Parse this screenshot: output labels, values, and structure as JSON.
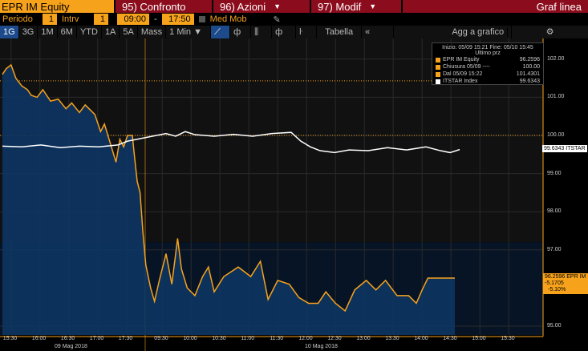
{
  "header": {
    "security": "EPR IM Equity",
    "compare": "95) Confronto",
    "actions": "96) Azioni",
    "modify": "97) Modif",
    "chart_type": "Graf linea"
  },
  "controls": {
    "period_label": "Periodo",
    "period": "1",
    "interval_label": "Intrv",
    "interval": "1",
    "start_time": "09:00",
    "dash": "-",
    "end_time": "17:50",
    "moving_avg": "Med Mob"
  },
  "toolbar": {
    "ranges": [
      "1G",
      "3G",
      "1M",
      "6M",
      "YTD",
      "1A",
      "5A",
      "Mass"
    ],
    "interval_select": "1 Min ▼",
    "table": "Tabella",
    "collapse": "«",
    "add_to_chart": "Agg a grafico",
    "settings": "⚙"
  },
  "legend": {
    "range": "Inizio: 05/09 15:21 Fine: 05/10 15:45",
    "header": "Ultimo prz",
    "items": [
      {
        "label": "EPR IM Equity",
        "value": "96.2596",
        "color": "#f7a21b"
      },
      {
        "label": "Chiusura 05/09 ---- ",
        "value": "100.00",
        "color": "#f7a21b"
      },
      {
        "label": "Dal 05/09 15:22",
        "value": "101.4301",
        "color": "#f7a21b"
      },
      {
        "label": "ITSTAR Index",
        "value": "99.6343",
        "color": "#ffffff"
      }
    ]
  },
  "tags": {
    "itstar": "99.6343 ITSTAR",
    "epr": "96.2596 EPR IM",
    "epr_chg": "-5.1705",
    "epr_pct": "-5.10%"
  },
  "chart_data": {
    "type": "line",
    "yticks": [
      "102.00",
      "101.00",
      "100.00",
      "99.00",
      "98.00",
      "97.00",
      "95.00"
    ],
    "ytick_values": [
      102,
      101,
      100,
      99,
      98,
      97,
      95
    ],
    "ylim": [
      94.8,
      102.7
    ],
    "xticks": [
      "15:30",
      "16:00",
      "16:30",
      "17:00",
      "17:30",
      "09:30",
      "10:00",
      "10:30",
      "11:00",
      "11:30",
      "12:00",
      "12:30",
      "13:00",
      "13:30",
      "14:00",
      "14:30",
      "15:00",
      "15:30"
    ],
    "xtick_minutes": [
      9,
      39,
      69,
      99,
      129,
      166,
      196,
      226,
      256,
      286,
      316,
      346,
      376,
      406,
      436,
      466,
      496,
      526
    ],
    "dates": [
      "09 Mag 2018",
      "10 Mag 2018"
    ],
    "reference_close": 100.0,
    "reference_start": 101.4301,
    "series": [
      {
        "name": "EPR IM Equity",
        "color": "#f7a21b",
        "points": [
          [
            0,
            101.6
          ],
          [
            4,
            101.75
          ],
          [
            9,
            101.85
          ],
          [
            14,
            101.5
          ],
          [
            20,
            101.3
          ],
          [
            26,
            101.2
          ],
          [
            30,
            101.05
          ],
          [
            36,
            101.0
          ],
          [
            42,
            101.2
          ],
          [
            50,
            100.9
          ],
          [
            58,
            100.95
          ],
          [
            66,
            100.7
          ],
          [
            72,
            100.85
          ],
          [
            80,
            100.6
          ],
          [
            86,
            100.8
          ],
          [
            96,
            100.55
          ],
          [
            102,
            100.1
          ],
          [
            106,
            100.3
          ],
          [
            112,
            99.8
          ],
          [
            118,
            99.3
          ],
          [
            122,
            99.9
          ],
          [
            126,
            99.7
          ],
          [
            130,
            100.0
          ],
          [
            135,
            100.0
          ],
          [
            137,
            99.5
          ],
          [
            140,
            98.8
          ],
          [
            143,
            98.5
          ],
          [
            146,
            97.45
          ],
          [
            149,
            96.6
          ],
          [
            154,
            96.0
          ],
          [
            158,
            95.65
          ],
          [
            163,
            96.2
          ],
          [
            170,
            96.9
          ],
          [
            176,
            96.1
          ],
          [
            182,
            97.3
          ],
          [
            186,
            96.5
          ],
          [
            192,
            96.0
          ],
          [
            200,
            95.8
          ],
          [
            208,
            96.3
          ],
          [
            214,
            96.55
          ],
          [
            220,
            95.9
          ],
          [
            230,
            96.3
          ],
          [
            245,
            96.55
          ],
          [
            258,
            96.3
          ],
          [
            268,
            96.7
          ],
          [
            276,
            95.7
          ],
          [
            286,
            96.2
          ],
          [
            298,
            96.1
          ],
          [
            308,
            95.75
          ],
          [
            318,
            95.6
          ],
          [
            328,
            95.6
          ],
          [
            336,
            95.9
          ],
          [
            346,
            95.6
          ],
          [
            356,
            95.4
          ],
          [
            366,
            95.95
          ],
          [
            378,
            96.2
          ],
          [
            388,
            95.95
          ],
          [
            398,
            96.2
          ],
          [
            410,
            95.8
          ],
          [
            422,
            95.8
          ],
          [
            430,
            95.6
          ],
          [
            436,
            95.95
          ],
          [
            442,
            96.26
          ],
          [
            470,
            96.26
          ]
        ]
      },
      {
        "name": "ITSTAR Index",
        "color": "#ffffff",
        "points": [
          [
            0,
            99.72
          ],
          [
            20,
            99.7
          ],
          [
            40,
            99.75
          ],
          [
            60,
            99.68
          ],
          [
            80,
            99.72
          ],
          [
            100,
            99.7
          ],
          [
            120,
            99.75
          ],
          [
            130,
            99.85
          ],
          [
            140,
            99.9
          ],
          [
            150,
            99.95
          ],
          [
            160,
            100.0
          ],
          [
            170,
            100.05
          ],
          [
            180,
            99.98
          ],
          [
            190,
            100.1
          ],
          [
            200,
            100.02
          ],
          [
            220,
            99.98
          ],
          [
            240,
            100.03
          ],
          [
            260,
            99.98
          ],
          [
            280,
            100.05
          ],
          [
            300,
            100.08
          ],
          [
            310,
            99.85
          ],
          [
            320,
            99.7
          ],
          [
            330,
            99.6
          ],
          [
            345,
            99.55
          ],
          [
            360,
            99.62
          ],
          [
            380,
            99.6
          ],
          [
            400,
            99.68
          ],
          [
            420,
            99.62
          ],
          [
            440,
            99.7
          ],
          [
            455,
            99.6
          ],
          [
            465,
            99.55
          ],
          [
            475,
            99.63
          ]
        ]
      }
    ]
  }
}
